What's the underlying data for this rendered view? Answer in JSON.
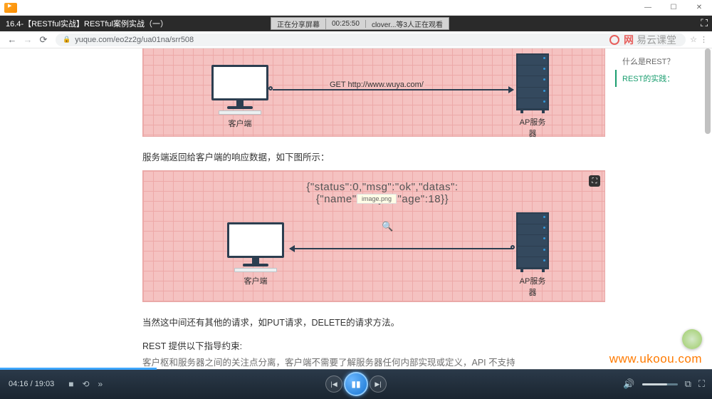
{
  "window": {
    "title": ""
  },
  "tab": {
    "title": "16.4-【RESTful实战】RESTful案例实战（一）"
  },
  "share": {
    "status": "正在分享屏幕",
    "time": "00:25:50",
    "viewers": "clover...等3人正在观看"
  },
  "address": {
    "url": "yuque.com/eo2z2g/ua01na/srr508"
  },
  "brand_overlay": "网易云课堂",
  "toc": {
    "item1": "什么是REST？",
    "item2": "REST的实践："
  },
  "diagram1": {
    "client_label": "客户端",
    "server_label": "AP服务器",
    "request_text": "GET http://www.wuya.com/"
  },
  "para1": "服务端返回给客户端的响应数据，如下图所示：",
  "diagram2": {
    "client_label": "客户端",
    "server_label": "AP服务器",
    "json_line1": "{\"status\":0,\"msg\":\"ok\",\"datas\":",
    "json_line2": "{\"name\":\"wuya\",\"age\":18}}",
    "tooltip": "image.png"
  },
  "para2": "当然这中间还有其他的请求，如PUT请求，DELETE的请求方法。",
  "para3": "REST 提供以下指导约束:",
  "para4": "客户枢和服务器之间的关注点分离，客户端不需要了解服务器任何内部实现或定义，API 不支持",
  "player": {
    "current": "04:16",
    "total": "19:03"
  },
  "watermark": "www.ukoou.com"
}
